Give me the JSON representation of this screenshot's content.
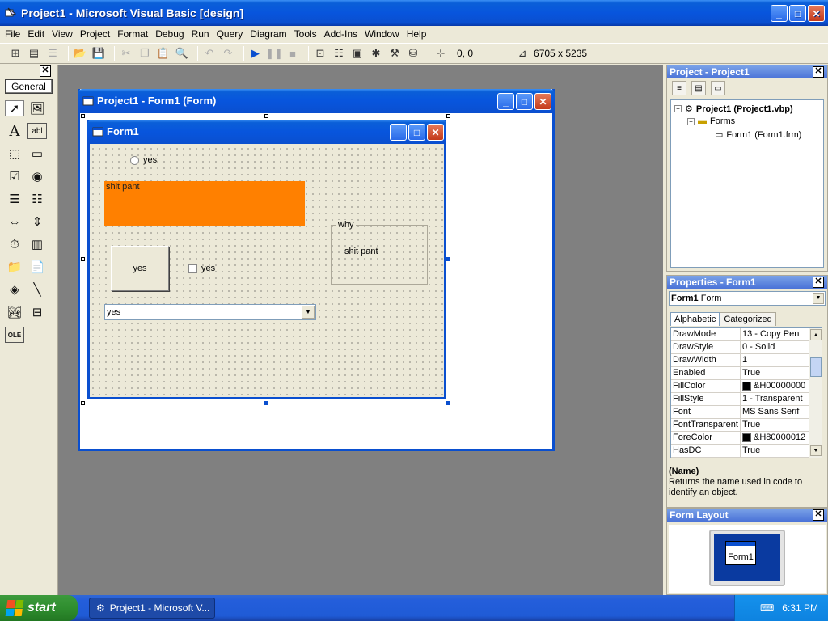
{
  "window": {
    "title": "Project1 - Microsoft Visual Basic [design]"
  },
  "menu": [
    "File",
    "Edit",
    "View",
    "Project",
    "Format",
    "Debug",
    "Run",
    "Query",
    "Diagram",
    "Tools",
    "Add-Ins",
    "Window",
    "Help"
  ],
  "toolbar": {
    "position": "0, 0",
    "size": "6705 x 5235"
  },
  "toolbox": {
    "tab_label": "General"
  },
  "designer": {
    "title": "Project1 - Form1 (Form)"
  },
  "form1": {
    "title": "Form1",
    "option_label": "yes",
    "label_text": "shit pant",
    "button_label": "yes",
    "checkbox_label": "yes",
    "frame_caption": "why",
    "frame_label": "shit pant",
    "combo_value": "yes",
    "label_color": "#ff8000"
  },
  "project_panel": {
    "title": "Project - Project1",
    "root": "Project1 (Project1.vbp)",
    "folder": "Forms",
    "item": "Form1 (Form1.frm)"
  },
  "properties_panel": {
    "title": "Properties - Form1",
    "object_name": "Form1",
    "object_type": "Form",
    "tabs": [
      "Alphabetic",
      "Categorized"
    ],
    "rows": [
      {
        "key": "DrawMode",
        "value": "13 - Copy Pen"
      },
      {
        "key": "DrawStyle",
        "value": "0 - Solid"
      },
      {
        "key": "DrawWidth",
        "value": "1"
      },
      {
        "key": "Enabled",
        "value": "True"
      },
      {
        "key": "FillColor",
        "value": "&H00000000"
      },
      {
        "key": "FillStyle",
        "value": "1 - Transparent"
      },
      {
        "key": "Font",
        "value": "MS Sans Serif"
      },
      {
        "key": "FontTransparent",
        "value": "True"
      },
      {
        "key": "ForeColor",
        "value": "&H80000012"
      },
      {
        "key": "HasDC",
        "value": "True"
      }
    ],
    "desc_title": "(Name)",
    "desc_text": "Returns the name used in code to identify an object."
  },
  "layout_panel": {
    "title": "Form Layout",
    "mini_form": "Form1"
  },
  "taskbar": {
    "start": "start",
    "task": "Project1 - Microsoft V...",
    "time": "6:31 PM"
  }
}
